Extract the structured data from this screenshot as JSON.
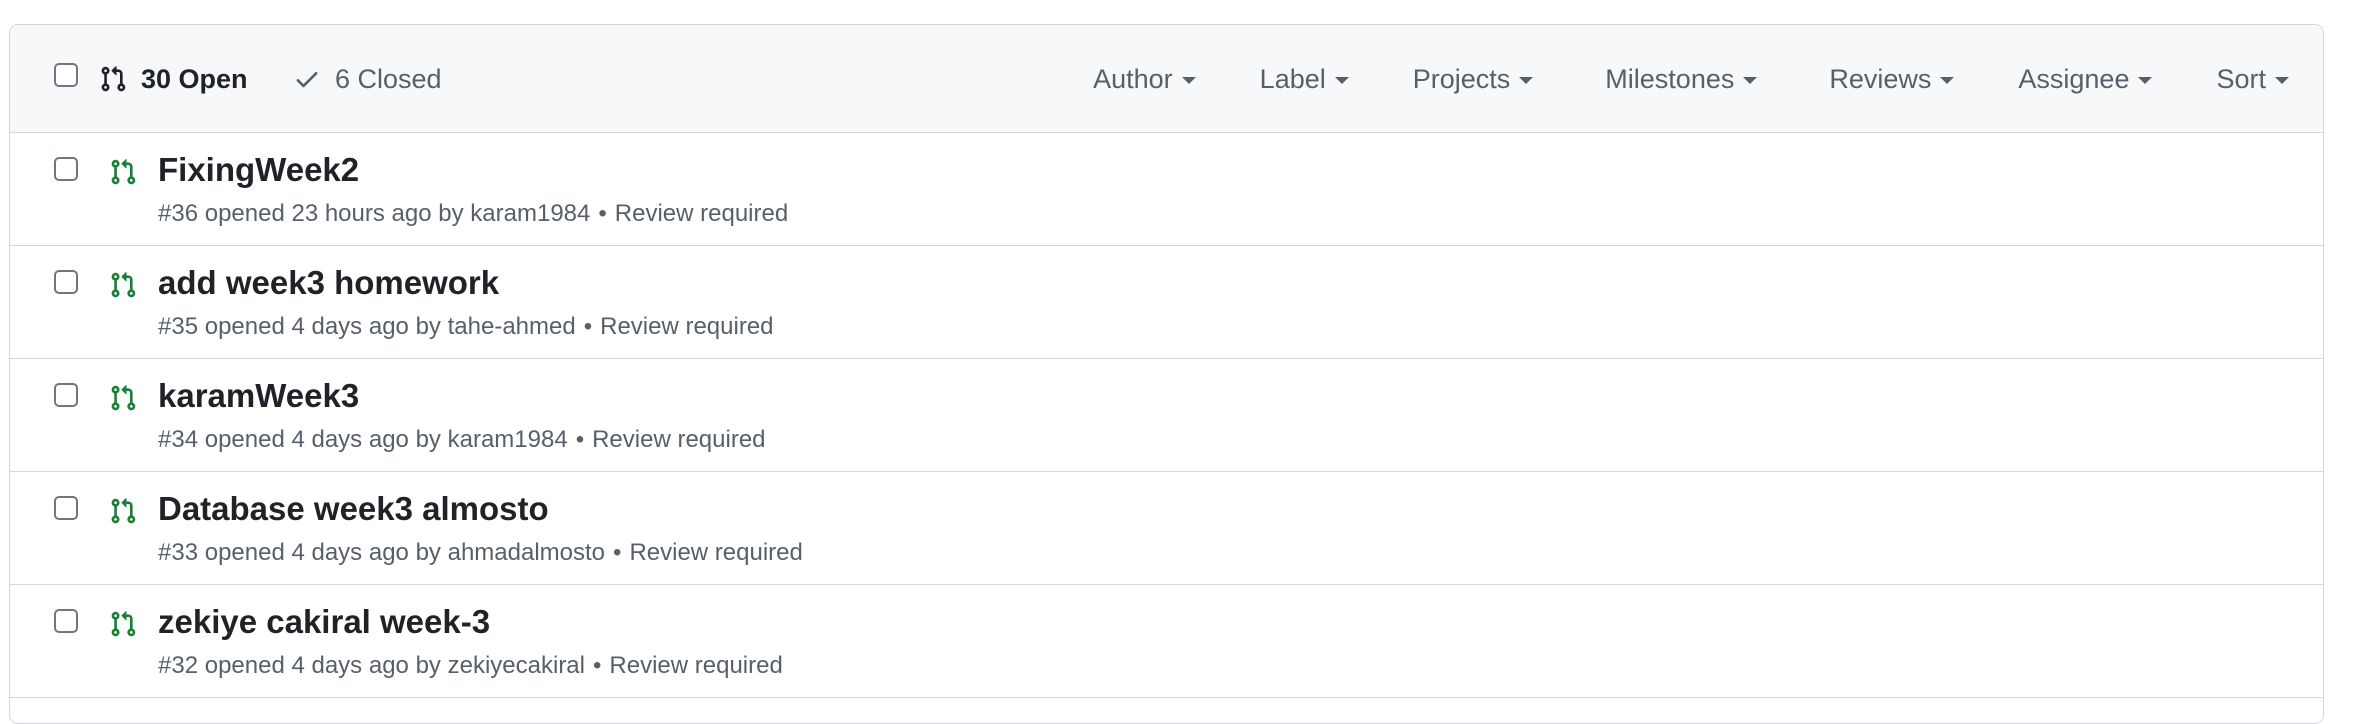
{
  "header": {
    "open_label": "30 Open",
    "closed_label": "6 Closed",
    "filters": [
      "Author",
      "Label",
      "Projects",
      "Milestones",
      "Reviews",
      "Assignee",
      "Sort"
    ]
  },
  "pulls": [
    {
      "title": "FixingWeek2",
      "number": "#36",
      "opened": "opened 23 hours ago",
      "by": "by",
      "author": "karam1984",
      "status": "Review required"
    },
    {
      "title": "add week3 homework",
      "number": "#35",
      "opened": "opened 4 days ago",
      "by": "by",
      "author": "tahe-ahmed",
      "status": "Review required"
    },
    {
      "title": "karamWeek3",
      "number": "#34",
      "opened": "opened 4 days ago",
      "by": "by",
      "author": "karam1984",
      "status": "Review required"
    },
    {
      "title": "Database week3 almosto",
      "number": "#33",
      "opened": "opened 4 days ago",
      "by": "by",
      "author": "ahmadalmosto",
      "status": "Review required"
    },
    {
      "title": "zekiye cakiral week-3",
      "number": "#32",
      "opened": "opened 4 days ago",
      "by": "by",
      "author": "zekiyecakiral",
      "status": "Review required"
    }
  ],
  "colors": {
    "open_icon": "#1a7f37",
    "muted_text": "#57606a",
    "border": "#d0d7de",
    "header_bg": "#f6f8fa"
  },
  "icons": {
    "open_state": "git-pull-request-icon",
    "closed_state": "check-icon",
    "row_state": "git-pull-request-open-icon"
  }
}
